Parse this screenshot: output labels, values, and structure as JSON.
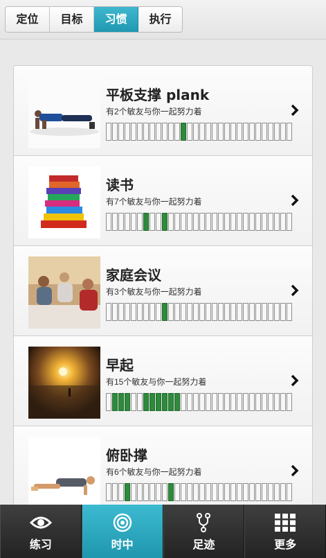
{
  "top_tabs": [
    {
      "label": "定位"
    },
    {
      "label": "目标"
    },
    {
      "label": "习惯",
      "active": true
    },
    {
      "label": "执行"
    }
  ],
  "habits": [
    {
      "title": "平板支撑 plank",
      "friends": "有2个敏友与你一起努力着",
      "progress": [
        12
      ]
    },
    {
      "title": "读书",
      "friends": "有7个敏友与你一起努力着",
      "progress": [
        6,
        9
      ]
    },
    {
      "title": "家庭会议",
      "friends": "有3个敏友与你一起努力着",
      "progress": [
        9
      ]
    },
    {
      "title": "早起",
      "friends": "有15个敏友与你一起努力着",
      "progress": [
        1,
        2,
        3,
        6,
        7,
        8,
        9,
        10,
        11
      ]
    },
    {
      "title": "俯卧撑",
      "friends": "有6个敏友与你一起努力着",
      "progress": [
        3,
        10
      ]
    }
  ],
  "progress_cells": 30,
  "bottom_nav": [
    {
      "label": "练习",
      "icon": "eye-icon"
    },
    {
      "label": "时中",
      "icon": "target-icon",
      "active": true
    },
    {
      "label": "足迹",
      "icon": "branch-icon"
    },
    {
      "label": "更多",
      "icon": "grid-icon"
    }
  ],
  "colors": {
    "accent": "#2aa7bf",
    "progress_on": "#2e8a3c"
  }
}
